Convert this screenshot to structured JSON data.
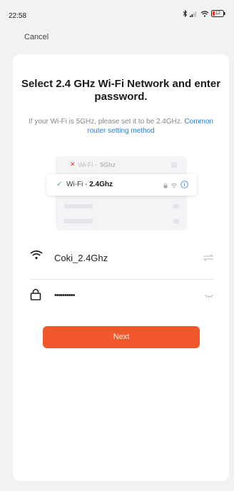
{
  "status_bar": {
    "time": "22:58",
    "battery": "12"
  },
  "header": {
    "cancel_label": "Cancel"
  },
  "main": {
    "title": "Select 2.4 GHz Wi-Fi Network and enter password.",
    "subtitle": "If your Wi-Fi is 5GHz, please set it to be 2.4GHz.",
    "link_text": "Common router setting method"
  },
  "illustration": {
    "row_5g_prefix": "Wi-Fi - ",
    "row_5g_band": "5Ghz",
    "row_24g_prefix": "Wi-Fi - ",
    "row_24g_band": "2.4Ghz"
  },
  "form": {
    "ssid_value": "Coki_2.4Ghz",
    "password_value": "••••••••••",
    "next_label": "Next"
  },
  "colors": {
    "accent": "#f0582b",
    "link": "#2a7fd4",
    "check": "#2bb673",
    "cross": "#e0392f"
  }
}
